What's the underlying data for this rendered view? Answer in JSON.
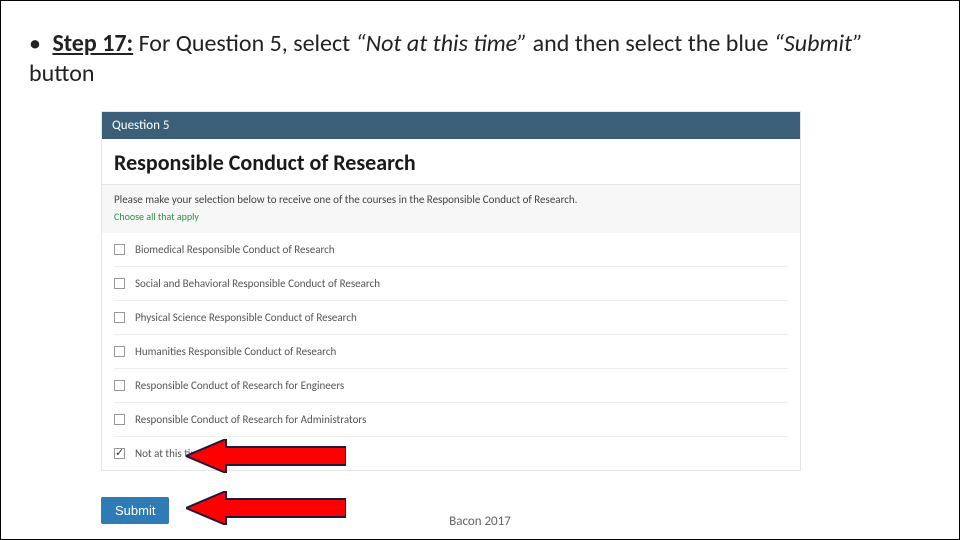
{
  "step": {
    "bullet": "•",
    "label": "Step 17:",
    "text_before_q": " For Question 5, select ",
    "quote1": "“Not at this time”",
    "text_mid": " and then select the blue ",
    "quote2": "“Submit”",
    "text_after": " button"
  },
  "panel": {
    "header": "Question 5",
    "title": "Responsible Conduct of Research",
    "subtext": "Please make your selection below to receive one of the courses in the Responsible Conduct of Research.",
    "hint": "Choose all that apply",
    "options": [
      {
        "label": "Biomedical Responsible Conduct of Research",
        "checked": false
      },
      {
        "label": "Social and Behavioral Responsible Conduct of Research",
        "checked": false
      },
      {
        "label": "Physical Science Responsible Conduct of Research",
        "checked": false
      },
      {
        "label": "Humanities Responsible Conduct of Research",
        "checked": false
      },
      {
        "label": "Responsible Conduct of Research for Engineers",
        "checked": false
      },
      {
        "label": "Responsible Conduct of Research for Administrators",
        "checked": false
      },
      {
        "label": "Not at this time.",
        "checked": true
      }
    ]
  },
  "submit": {
    "label": "Submit"
  },
  "footer": {
    "text": "Bacon 2017"
  },
  "colors": {
    "arrow_fill": "#ff0000",
    "arrow_stroke": "#1a1a40"
  }
}
